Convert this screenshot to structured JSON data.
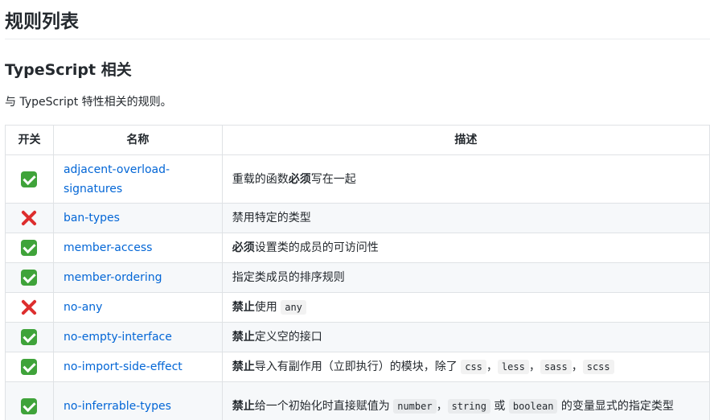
{
  "page_title": "规则列表",
  "section": {
    "title": "TypeScript 相关",
    "intro": "与 TypeScript 特性相关的规则。"
  },
  "table": {
    "headers": [
      "开关",
      "名称",
      "描述"
    ],
    "rows": [
      {
        "enabled": true,
        "name": "adjacent-overload-signatures",
        "desc": [
          {
            "t": "重载的函数"
          },
          {
            "t": "必须",
            "b": true
          },
          {
            "t": "写在一起"
          }
        ]
      },
      {
        "enabled": false,
        "name": "ban-types",
        "desc": [
          {
            "t": "禁用特定的类型"
          }
        ]
      },
      {
        "enabled": true,
        "name": "member-access",
        "desc": [
          {
            "t": "必须",
            "b": true
          },
          {
            "t": "设置类的成员的可访问性"
          }
        ]
      },
      {
        "enabled": true,
        "name": "member-ordering",
        "desc": [
          {
            "t": "指定类成员的排序规则"
          }
        ]
      },
      {
        "enabled": false,
        "name": "no-any",
        "desc": [
          {
            "t": "禁止",
            "b": true
          },
          {
            "t": "使用 "
          },
          {
            "t": "any",
            "code": true
          }
        ]
      },
      {
        "enabled": true,
        "name": "no-empty-interface",
        "desc": [
          {
            "t": "禁止",
            "b": true
          },
          {
            "t": "定义空的接口"
          }
        ]
      },
      {
        "enabled": true,
        "name": "no-import-side-effect",
        "desc": [
          {
            "t": "禁止",
            "b": true
          },
          {
            "t": "导入有副作用（立即执行）的模块，除了 "
          },
          {
            "t": "css",
            "code": true
          },
          {
            "t": "，"
          },
          {
            "t": "less",
            "code": true
          },
          {
            "t": "，"
          },
          {
            "t": "sass",
            "code": true
          },
          {
            "t": "，"
          },
          {
            "t": "scss",
            "code": true
          }
        ]
      },
      {
        "enabled": true,
        "name": "no-inferrable-types",
        "desc": [
          {
            "t": "禁止",
            "b": true
          },
          {
            "t": "给一个初始化时直接赋值为 "
          },
          {
            "t": "number",
            "code": true
          },
          {
            "t": "，"
          },
          {
            "t": "string",
            "code": true
          },
          {
            "t": " 或 "
          },
          {
            "t": "boolean",
            "code": true
          },
          {
            "t": " 的变量显式的指定类型"
          }
        ]
      }
    ]
  },
  "colors": {
    "link": "#0366d6",
    "check": "#3fa33a",
    "cross": "#dd2e2e"
  }
}
